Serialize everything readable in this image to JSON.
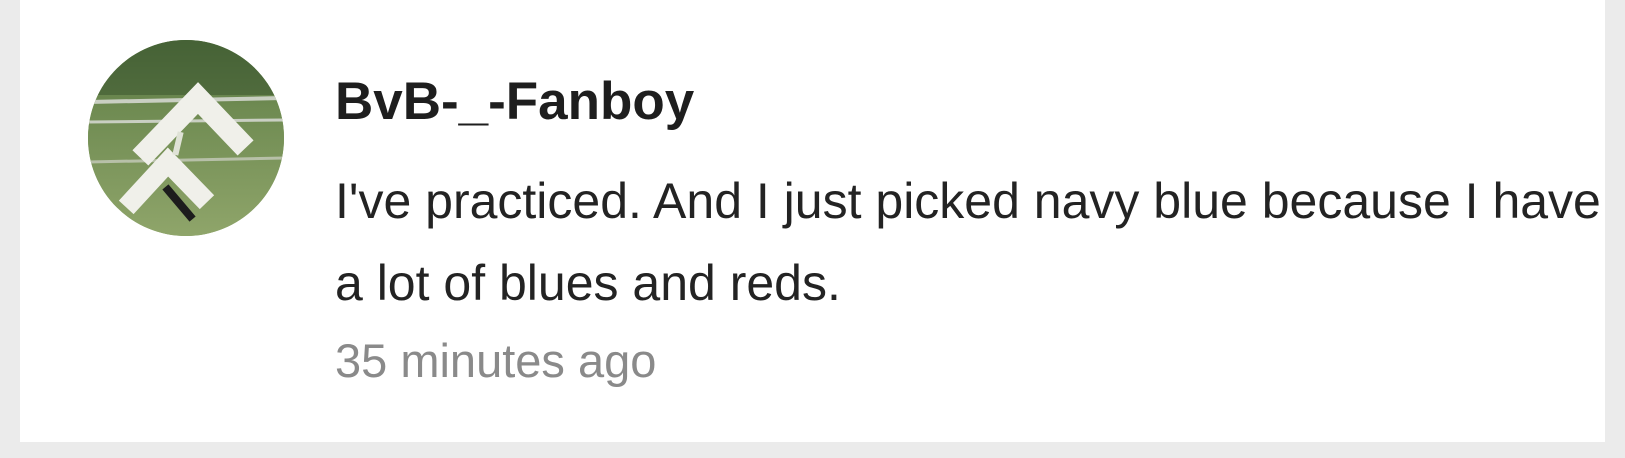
{
  "comment": {
    "avatar_icon": "user-avatar-photo",
    "username": "BvB-_-Fanboy",
    "text": "I've practiced. And I just picked navy blue because I have a lot of blues and reds.",
    "timestamp": "35 minutes ago"
  },
  "colors": {
    "background": "#ebebeb",
    "card": "#ffffff",
    "username": "#1e1e1e",
    "text": "#232323",
    "timestamp": "#8a8a8a"
  }
}
